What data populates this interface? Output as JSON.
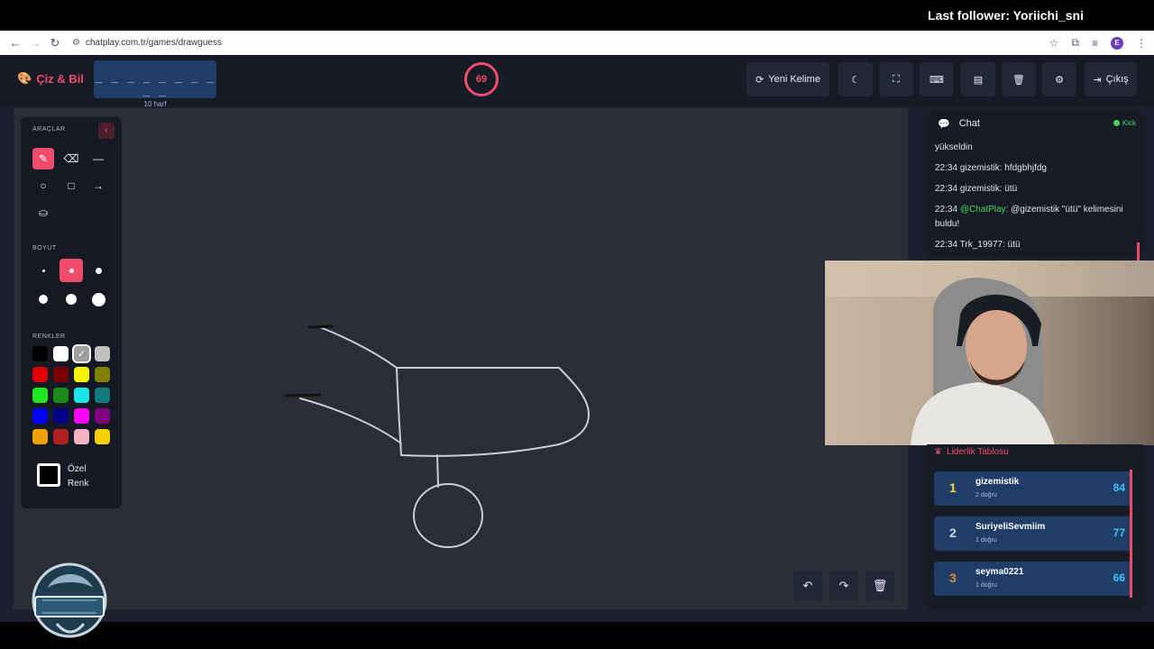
{
  "overlay": {
    "follower_text": "Last follower: Yoriichi_sni"
  },
  "browser": {
    "url": "chatplay.com.tr/games/drawguess",
    "profile_initial": "E"
  },
  "header": {
    "brand": "Çiz & Bil",
    "word_dashes": "_ _ _ _ _ _ _ _ _ _",
    "word_hint": "10 harf",
    "timer": "69",
    "new_word_label": "Yeni Kelime",
    "exit_label": "Çıkış"
  },
  "toolbox": {
    "tools_title": "ARAÇLAR",
    "size_title": "BOYUT",
    "colors_title": "RENKLER",
    "custom_color_line1": "Özel",
    "custom_color_line2": "Renk",
    "palette": [
      "#000000",
      "#ffffff",
      "#9e9e9e",
      "#c0c0c0",
      "#e00000",
      "#7a0000",
      "#f5f500",
      "#808000",
      "#1ee51e",
      "#1a8a1a",
      "#19e6e6",
      "#117a7a",
      "#0000ff",
      "#00008a",
      "#ff00ff",
      "#800080",
      "#f0a000",
      "#b02020",
      "#f4b4c4",
      "#f5d000"
    ]
  },
  "chat": {
    "title": "Chat",
    "status": "Kick",
    "messages": [
      {
        "time": "",
        "user": "",
        "text": "yükseldin"
      },
      {
        "time": "22:34",
        "user": "gizemistik:",
        "text": "hfdgbhjfdg"
      },
      {
        "time": "22:34",
        "user": "gizemistik:",
        "text": "ütü"
      },
      {
        "time": "22:34",
        "user": "@ChatPlay:",
        "text": "@gizemistik \"ütü\" kelimesini buldu!"
      },
      {
        "time": "22:34",
        "user": "Trk_19977:",
        "text": "ütü"
      }
    ]
  },
  "leaderboard": {
    "title": "Liderlik Tablosu",
    "rows": [
      {
        "rank": "1",
        "name": "gizemistik",
        "sub": "2 doğru",
        "score": "84",
        "rank_color": "#ffd23f"
      },
      {
        "rank": "2",
        "name": "SuriyeliSevmiim",
        "sub": "1 doğru",
        "score": "77",
        "rank_color": "#cfd6e2"
      },
      {
        "rank": "3",
        "name": "seyma0221",
        "sub": "1 doğru",
        "score": "66",
        "rank_color": "#e08a3c"
      }
    ]
  },
  "colors": {
    "accent": "#ef4c6b",
    "panel_blue": "#1f3d66",
    "score_blue": "#3fc3ff"
  }
}
